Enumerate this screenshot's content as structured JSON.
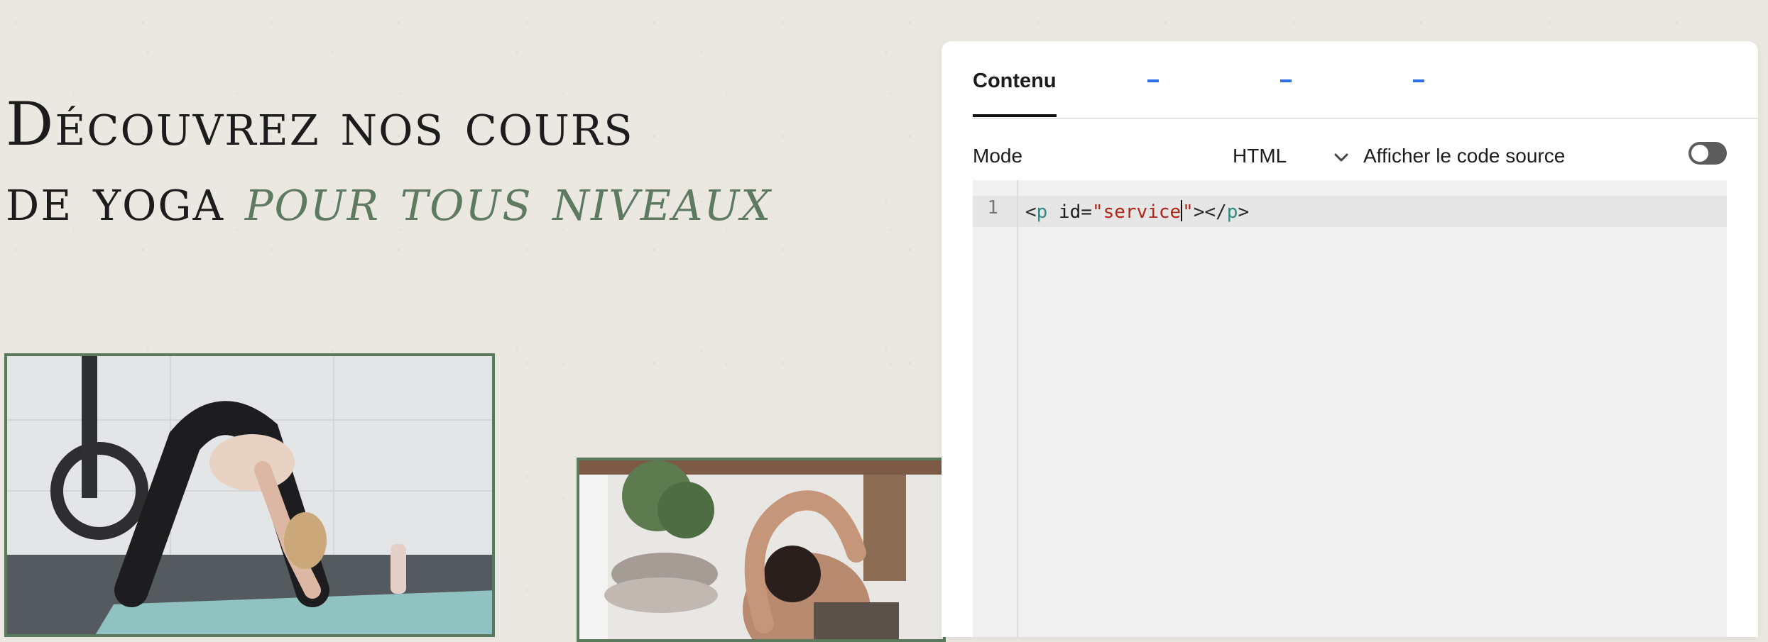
{
  "hero": {
    "title_line1": "Découvrez nos cours",
    "title_line2_plain": "de yoga ",
    "title_line2_accent": "pour tous niveaux"
  },
  "colors": {
    "accent": "#5e7a61",
    "frame": "#5a7a5d",
    "handle": "#2f6fe8"
  },
  "panel": {
    "tabs": [
      {
        "label": "Contenu",
        "active": true
      }
    ],
    "mode_label": "Mode",
    "mode_value": "HTML",
    "source_label": "Afficher le code source",
    "source_toggle_on": false,
    "editor": {
      "line_number": "1",
      "code": {
        "open_lt": "<",
        "tag1": "p",
        "attr": " id=",
        "str_before_caret": "\"service",
        "str_after_caret": "\"",
        "mid": "></",
        "tag2": "p",
        "close_gt": ">"
      }
    }
  },
  "icons": {
    "mode_dropdown": "chevron-down-icon"
  }
}
